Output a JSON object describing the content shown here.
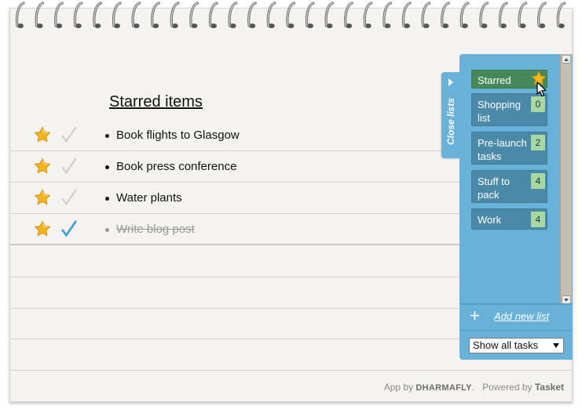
{
  "list": {
    "title": "Starred items",
    "tasks": [
      {
        "text": "Book flights to Glasgow",
        "starred": true,
        "done": false
      },
      {
        "text": "Book press conference",
        "starred": true,
        "done": false
      },
      {
        "text": "Water plants",
        "starred": true,
        "done": false
      },
      {
        "text": "Write blog post",
        "starred": true,
        "done": true
      }
    ]
  },
  "sidebar": {
    "close_label": "Close lists",
    "lists": [
      {
        "name": "Starred",
        "count": null,
        "active": true
      },
      {
        "name": "Shopping list",
        "count": "0"
      },
      {
        "name": "Pre-launch tasks",
        "count": "2"
      },
      {
        "name": "Stuff to pack",
        "count": "4"
      },
      {
        "name": "Work",
        "count": "4"
      }
    ],
    "add_label": "Add new list",
    "filter_value": "Show all tasks"
  },
  "footer": {
    "app_by": "App by",
    "brand": "DHARMAFLY",
    "powered": "Powered by",
    "powered_brand": "Tasket"
  },
  "colors": {
    "panel": "#68b1d8",
    "list_item": "#4b89a8",
    "active_item": "#46885a",
    "count_badge": "#a8d8a0",
    "check_done": "#3fa0d4",
    "star": "#f3b51b"
  }
}
